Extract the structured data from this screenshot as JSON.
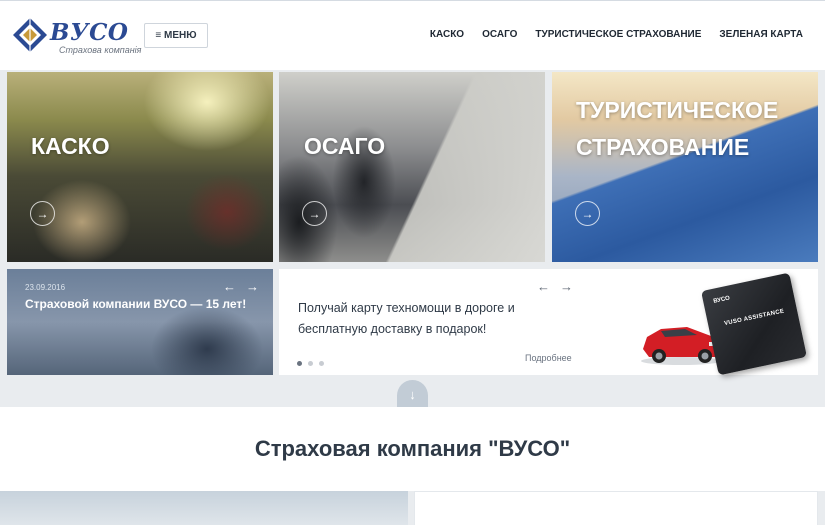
{
  "header": {
    "logo_name": "ВУСО",
    "logo_sub": "Страхова компанія",
    "menu_label": "≡ МЕНЮ",
    "nav": [
      "КАСКО",
      "ОСАГО",
      "ТУРИСТИЧЕСКОЕ СТРАХОВАНИЕ",
      "ЗЕЛЕНАЯ КАРТА"
    ]
  },
  "tiles": [
    {
      "title_line1": "КАСКО",
      "title_line2": ""
    },
    {
      "title_line1": "ОСАГО",
      "title_line2": ""
    },
    {
      "title_line1": "ТУРИСТИЧЕСКОЕ",
      "title_line2": "СТРАХОВАНИЕ"
    }
  ],
  "news": {
    "date": "23.09.2016",
    "text": "Страховой компании ВУСО — 15 лет!",
    "prev": "←",
    "next": "→"
  },
  "promo": {
    "text": "Получай карту техномощи в дороге и бесплатную доставку в подарок!",
    "more": "Подробнее",
    "prev": "←",
    "next": "→",
    "card_brand": "ВУСО",
    "card_name": "VUSO ASSISTANCE"
  },
  "scroll_arrow": "↓",
  "section": {
    "title": "Страховая компания \"ВУСО\""
  },
  "colors": {
    "brand": "#2b4a93",
    "text": "#2f3a47",
    "page_bg": "#e9ecef"
  }
}
